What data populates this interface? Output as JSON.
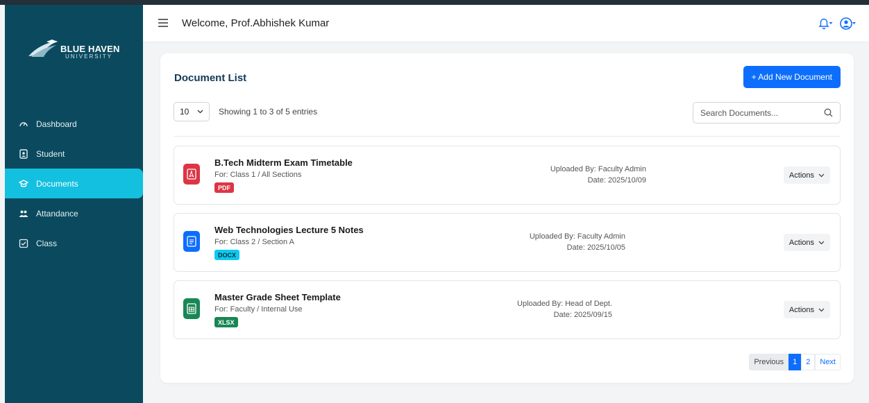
{
  "brand": {
    "name": "BLUE HAVEN",
    "subtitle": "UNIVERSITY"
  },
  "sidebar": {
    "items": [
      {
        "label": "Dashboard",
        "icon": "dashboard-gauge-icon",
        "active": false
      },
      {
        "label": "Student",
        "icon": "student-id-icon",
        "active": false
      },
      {
        "label": "Documents",
        "icon": "graduation-cap-icon",
        "active": true
      },
      {
        "label": "Attandance",
        "icon": "people-icon",
        "active": false
      },
      {
        "label": "Class",
        "icon": "checkbox-icon",
        "active": false
      }
    ]
  },
  "header": {
    "welcome": "Welcome, Prof.Abhishek Kumar"
  },
  "main": {
    "title": "Document List",
    "add_button": "+ Add New Document",
    "page_length": "10",
    "showing": "Showing 1 to 3 of 5 entries",
    "search_placeholder": "Search Documents..."
  },
  "documents": [
    {
      "name": "B.Tech Midterm Exam Timetable",
      "for": "For: Class 1 / All Sections",
      "type": "PDF",
      "uploaded_by": "Uploaded By: Faculty Admin",
      "date": "Date: 2025/10/09",
      "icon": "pdf-file-icon",
      "color": "#dc3545",
      "badge_color": "#dc3545",
      "badge_text_color": "#ffffff",
      "actions": "Actions"
    },
    {
      "name": "Web Technologies Lecture 5 Notes",
      "for": "For: Class 2 / Section A",
      "type": "DOCX",
      "uploaded_by": "Uploaded By: Faculty Admin",
      "date": "Date: 2025/10/05",
      "icon": "docx-file-icon",
      "color": "#0d6efd",
      "badge_color": "#0dcaf0",
      "badge_text_color": "#0a2a3a",
      "actions": "Actions"
    },
    {
      "name": "Master Grade Sheet Template",
      "for": "For: Faculty / Internal Use",
      "type": "XLSX",
      "uploaded_by": "Uploaded By: Head of Dept.",
      "date": "Date: 2025/09/15",
      "icon": "xlsx-file-icon",
      "color": "#198754",
      "badge_color": "#198754",
      "badge_text_color": "#ffffff",
      "actions": "Actions"
    }
  ],
  "pagination": {
    "previous": "Previous",
    "pages": [
      "1",
      "2"
    ],
    "current": "1",
    "next": "Next"
  }
}
